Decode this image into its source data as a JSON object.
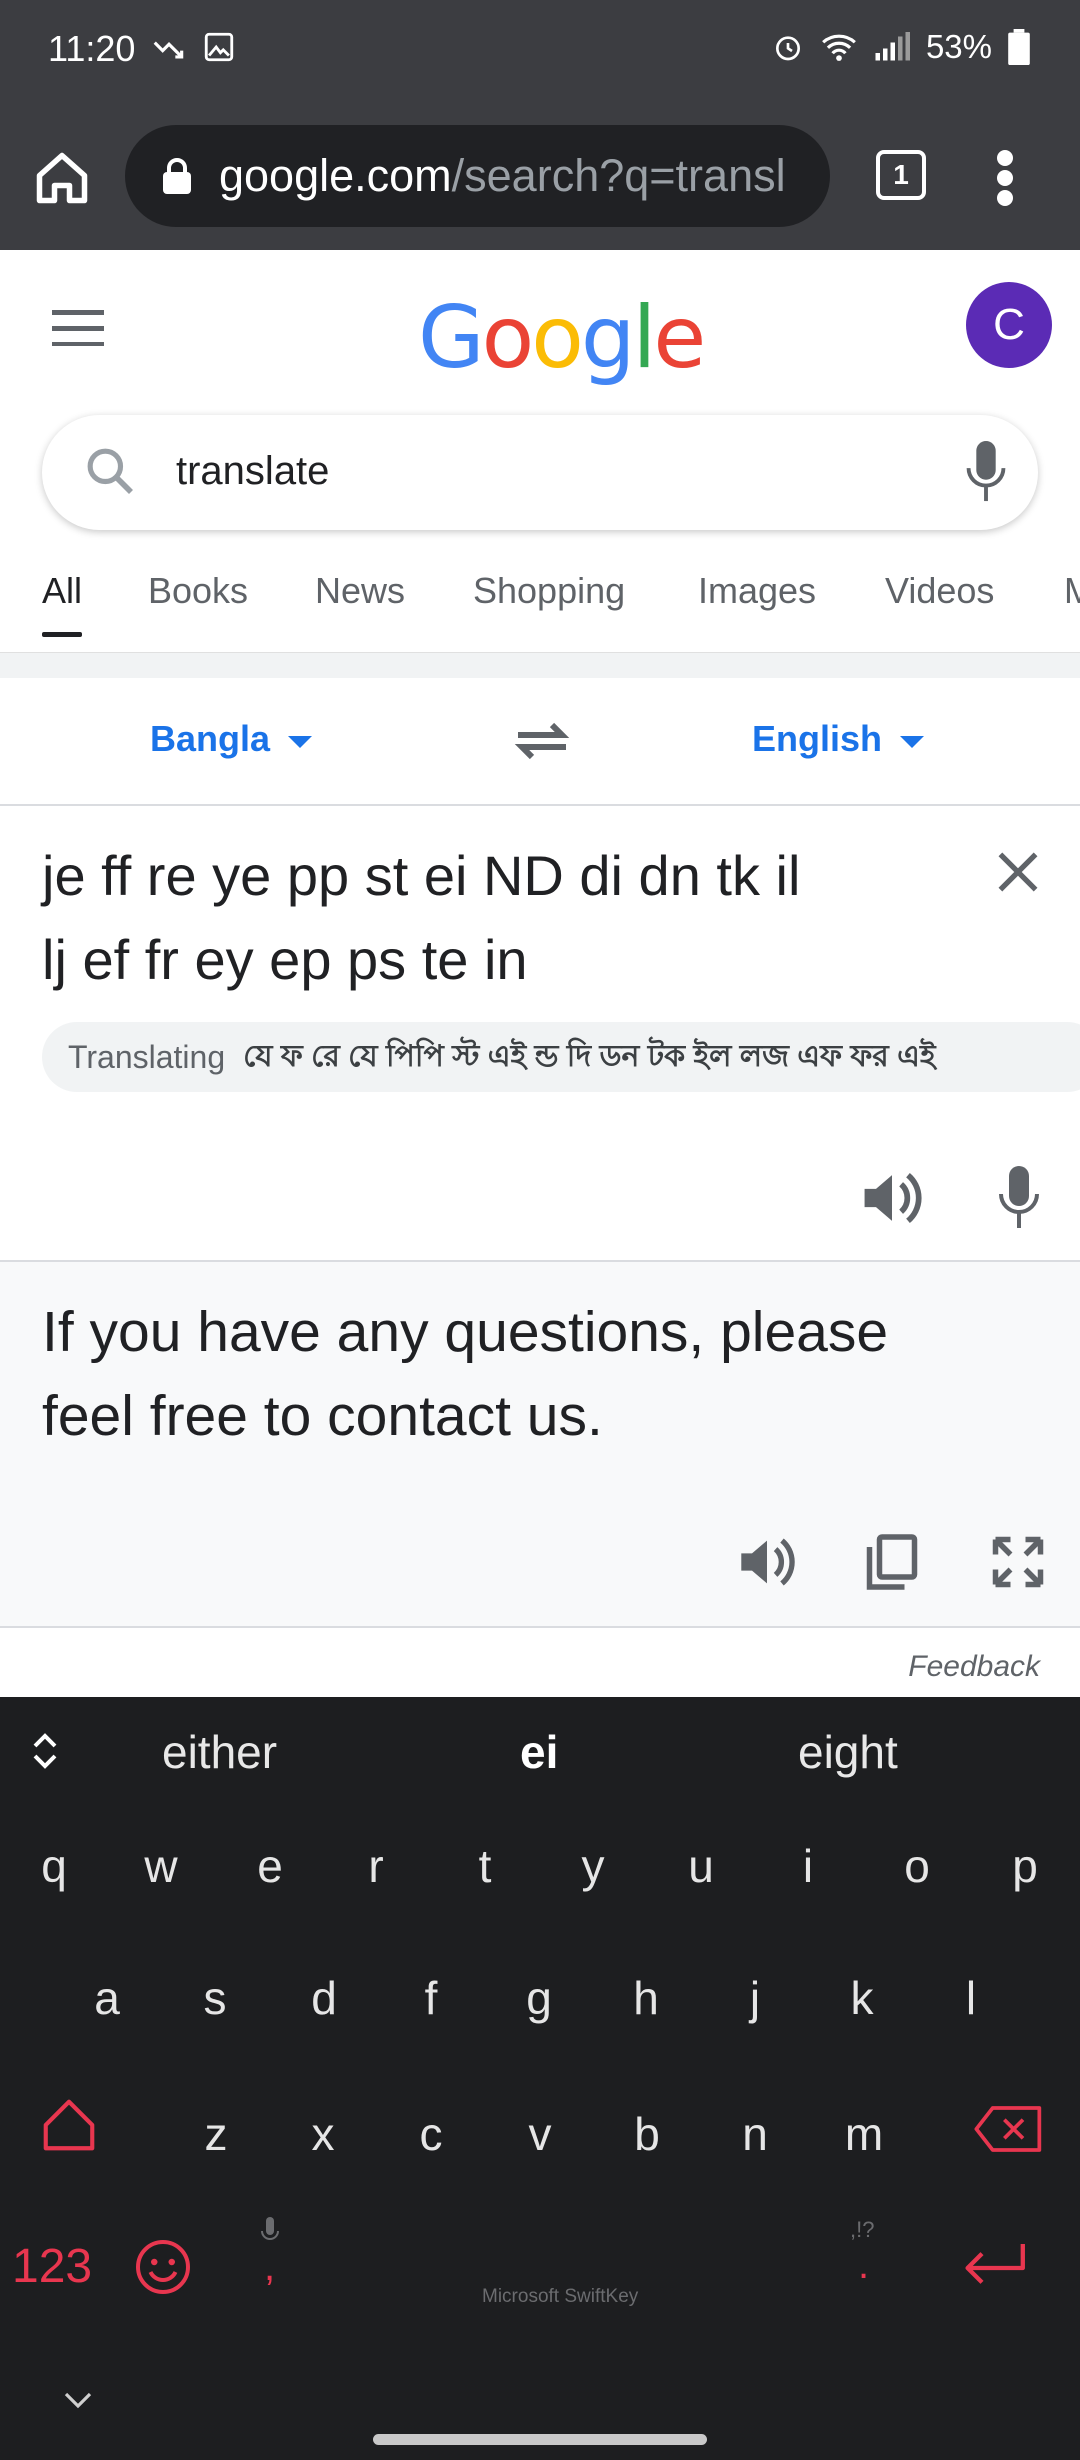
{
  "status_bar": {
    "time": "11:20",
    "battery": "53%"
  },
  "browser": {
    "url_host": "google.com",
    "url_path": "/search?q=transl",
    "tab_count": "1"
  },
  "google": {
    "logo": [
      "G",
      "o",
      "o",
      "g",
      "l",
      "e"
    ],
    "logo_colors": [
      "#4285F4",
      "#EA4335",
      "#FBBC05",
      "#4285F4",
      "#34A853",
      "#EA4335"
    ],
    "avatar_initial": "C",
    "search_query": "translate",
    "tabs": [
      "All",
      "Books",
      "News",
      "Shopping",
      "Images",
      "Videos",
      "M"
    ]
  },
  "translate": {
    "source_lang": "Bangla",
    "target_lang": "English",
    "source_text_line1": "je ff re ye pp st ei ND di dn tk il",
    "source_text_line2": "lj ef fr ey ep ps te in",
    "translating_label": "Translating",
    "bengali_text": "যে ফ রে যে পিপি স্ট এই ন্ড দি ডন টক ইল লজ এফ ফর এই",
    "translated_line1": "If you have any questions, please",
    "translated_line2": "feel free to contact us.",
    "feedback": "Feedback"
  },
  "keyboard": {
    "suggestions": [
      "either",
      "ei",
      "eight"
    ],
    "row1": [
      "q",
      "w",
      "e",
      "r",
      "t",
      "y",
      "u",
      "i",
      "o",
      "p"
    ],
    "row2": [
      "a",
      "s",
      "d",
      "f",
      "g",
      "h",
      "j",
      "k",
      "l"
    ],
    "row3": [
      "z",
      "x",
      "c",
      "v",
      "b",
      "n",
      "m"
    ],
    "num_key": "123",
    "comma": ",",
    "period": ".",
    "punct_hint": ",!?",
    "brand": "Microsoft SwiftKey",
    "accent_color": "#e8364f"
  }
}
